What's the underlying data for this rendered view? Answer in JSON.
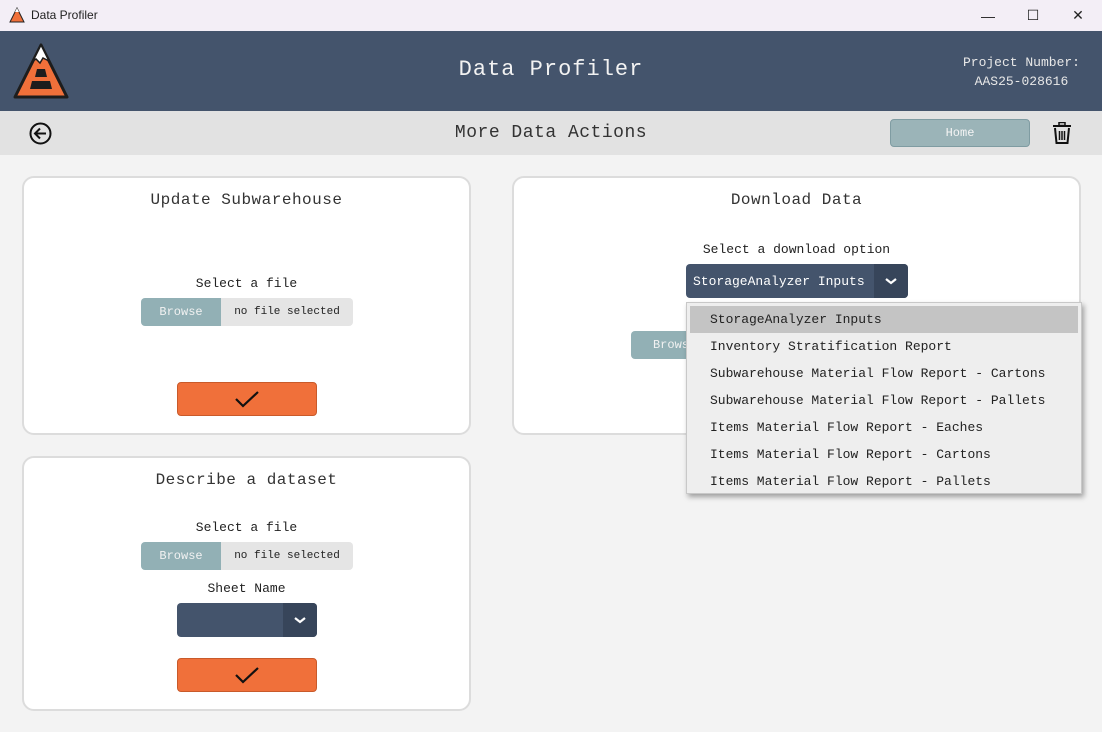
{
  "window": {
    "title": "Data Profiler",
    "controls": {
      "minimize": "—",
      "maximize": "☐",
      "close": "✕"
    }
  },
  "header": {
    "app_title": "Data Profiler",
    "project_label": "Project Number:",
    "project_number": "AAS25-028616",
    "logo_letter": "A"
  },
  "subbar": {
    "title": "More Data Actions",
    "home_label": "Home"
  },
  "update_card": {
    "title": "Update Subwarehouse",
    "select_label": "Select a file",
    "browse_label": "Browse",
    "file_status": "no file selected"
  },
  "describe_card": {
    "title": "Describe a dataset",
    "select_label": "Select a file",
    "browse_label": "Browse",
    "file_status": "no file selected",
    "sheet_label": "Sheet Name",
    "sheet_value": ""
  },
  "download_card": {
    "title": "Download Data",
    "select_label": "Select a download option",
    "selected_option": "StorageAnalyzer Inputs",
    "browse_label": "Brows",
    "options": [
      "StorageAnalyzer Inputs",
      "Inventory Stratification Report",
      "Subwarehouse Material Flow Report - Cartons",
      "Subwarehouse Material Flow Report - Pallets",
      "Items Material Flow Report - Eaches",
      "Items Material Flow Report - Cartons",
      "Items Material Flow Report - Pallets"
    ]
  },
  "colors": {
    "header": "#44546c",
    "accent_orange": "#f0703a",
    "browse_teal": "#92b0b5"
  }
}
